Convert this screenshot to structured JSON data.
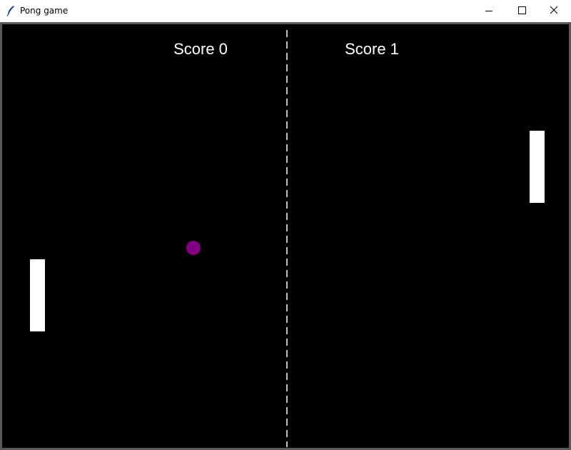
{
  "window": {
    "title": "Pong game",
    "icon": "feather-icon",
    "controls": [
      "minimize-icon",
      "maximize-icon",
      "close-icon"
    ]
  },
  "game": {
    "background_color": "#000000",
    "foreground_color": "#ffffff",
    "ball_color": "#800080",
    "score_left_label": "Score 0",
    "score_right_label": "Score 1",
    "score_left": 0,
    "score_right": 1
  }
}
